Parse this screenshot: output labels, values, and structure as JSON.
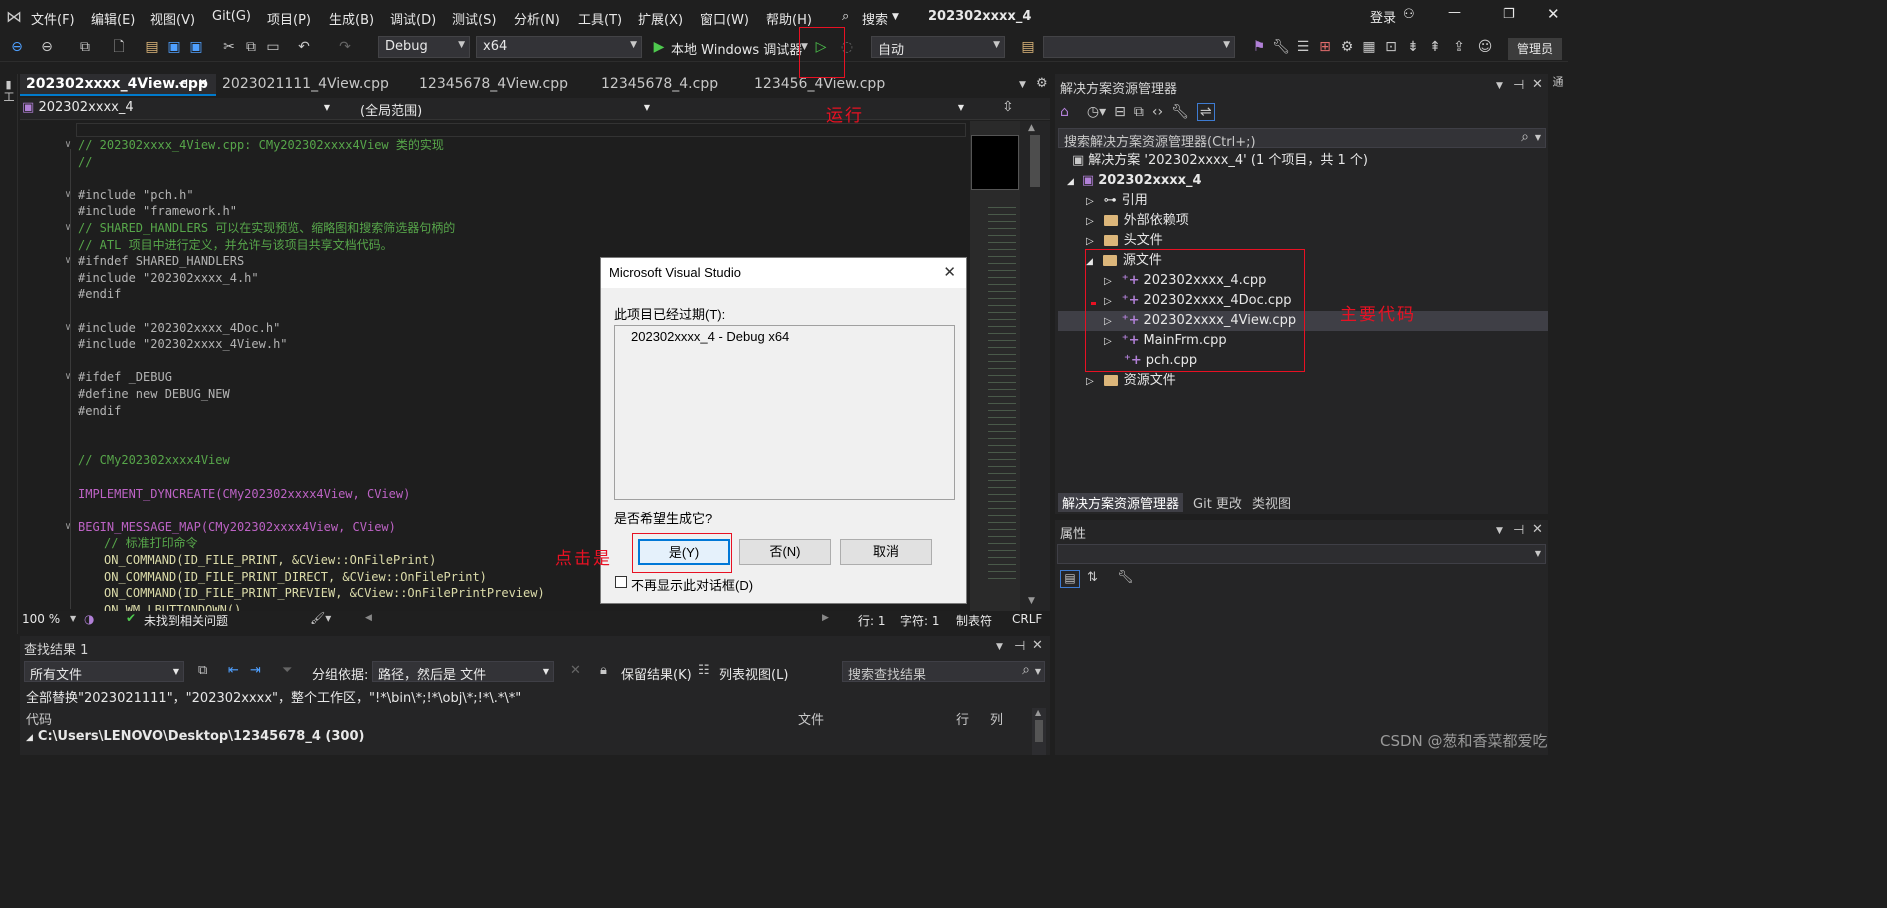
{
  "menu": {
    "items": [
      "文件(F)",
      "编辑(E)",
      "视图(V)",
      "Git(G)",
      "项目(P)",
      "生成(B)",
      "调试(D)",
      "测试(S)",
      "分析(N)",
      "工具(T)",
      "扩展(X)",
      "窗口(W)",
      "帮助(H)"
    ],
    "search_label": "搜索",
    "window_title": "202302xxxx_4",
    "login": "登录",
    "admin": "管理员"
  },
  "toolbar": {
    "config": "Debug",
    "platform": "x64",
    "run_target": "本地 Windows 调试器",
    "auto": "自动"
  },
  "tabs": [
    "202302xxxx_4View.cpp",
    "2023021111_4View.cpp",
    "12345678_4View.cpp",
    "12345678_4.cpp",
    "123456_4View.cpp"
  ],
  "navbar": {
    "project": "202302xxxx_4",
    "scope": "(全局范围)"
  },
  "code": {
    "lines": [
      {
        "t": "// 202302xxxx_4View.cpp: CMy202302xxxx4View 类的实现",
        "c": "cm",
        "indent": 0,
        "fold": true
      },
      {
        "t": "//",
        "c": "cm",
        "indent": 0
      },
      {
        "t": "",
        "c": "",
        "indent": 0
      },
      {
        "t": "#include \"pch.h\"",
        "c": "pp",
        "indent": 0,
        "fold": true
      },
      {
        "t": "#include \"framework.h\"",
        "c": "pp",
        "indent": 0
      },
      {
        "t": "// SHARED_HANDLERS 可以在实现预览、缩略图和搜索筛选器句柄的",
        "c": "cm",
        "indent": 0,
        "fold": true
      },
      {
        "t": "// ATL 项目中进行定义，并允许与该项目共享文档代码。",
        "c": "cm",
        "indent": 0
      },
      {
        "t": "#ifndef SHARED_HANDLERS",
        "c": "pp",
        "indent": 0,
        "fold": true
      },
      {
        "t": "#include \"202302xxxx_4.h\"",
        "c": "pp",
        "indent": 0
      },
      {
        "t": "#endif",
        "c": "pp",
        "indent": 0
      },
      {
        "t": "",
        "c": "",
        "indent": 0
      },
      {
        "t": "#include \"202302xxxx_4Doc.h\"",
        "c": "pp",
        "indent": 0,
        "fold": true
      },
      {
        "t": "#include \"202302xxxx_4View.h\"",
        "c": "pp",
        "indent": 0
      },
      {
        "t": "",
        "c": "",
        "indent": 0
      },
      {
        "t": "#ifdef _DEBUG",
        "c": "pp",
        "indent": 0,
        "fold": true
      },
      {
        "t": "#define new DEBUG_NEW",
        "c": "pp",
        "indent": 0
      },
      {
        "t": "#endif",
        "c": "pp",
        "indent": 0
      },
      {
        "t": "",
        "c": "",
        "indent": 0
      },
      {
        "t": "",
        "c": "",
        "indent": 0
      },
      {
        "t": "// CMy202302xxxx4View",
        "c": "cm",
        "indent": 0
      },
      {
        "t": "",
        "c": "",
        "indent": 0
      },
      {
        "t": "IMPLEMENT_DYNCREATE(CMy202302xxxx4View, CView)",
        "c": "mac",
        "indent": 0
      },
      {
        "t": "",
        "c": "",
        "indent": 0
      },
      {
        "t": "BEGIN_MESSAGE_MAP(CMy202302xxxx4View, CView)",
        "c": "mac",
        "indent": 0,
        "fold": true
      },
      {
        "t": "// 标准打印命令",
        "c": "cm",
        "indent": 2
      },
      {
        "t": "ON_COMMAND(ID_FILE_PRINT, &CView::OnFilePrint)",
        "c": "fn",
        "indent": 2
      },
      {
        "t": "ON_COMMAND(ID_FILE_PRINT_DIRECT, &CView::OnFilePrint)",
        "c": "fn",
        "indent": 2
      },
      {
        "t": "ON_COMMAND(ID_FILE_PRINT_PREVIEW, &CView::OnFilePrintPreview)",
        "c": "fn",
        "indent": 2
      },
      {
        "t": "ON_WM_LBUTTONDOWN()",
        "c": "fn",
        "indent": 2
      }
    ]
  },
  "editor_status": {
    "zoom": "100 %",
    "issues": "未找到相关问题",
    "line": "行: 1",
    "char": "字符: 1",
    "tabs": "制表符",
    "eol": "CRLF"
  },
  "solution": {
    "title": "解决方案资源管理器",
    "search_placeholder": "搜索解决方案资源管理器(Ctrl+;)",
    "root": "解决方案 '202302xxxx_4' (1 个项目，共 1 个)",
    "project": "202302xxxx_4",
    "nodes": {
      "refs": "引用",
      "external": "外部依赖项",
      "headers": "头文件",
      "sources": "源文件",
      "resources": "资源文件"
    },
    "source_files": [
      "202302xxxx_4.cpp",
      "202302xxxx_4Doc.cpp",
      "202302xxxx_4View.cpp",
      "MainFrm.cpp",
      "pch.cpp"
    ],
    "bottom_tabs": [
      "解决方案资源管理器",
      "Git 更改",
      "类视图"
    ]
  },
  "properties": {
    "title": "属性"
  },
  "find": {
    "title": "查找结果 1",
    "scope": "所有文件",
    "group_label": "分组依据:",
    "group_value": "路径，然后是 文件",
    "keep": "保留结果(K)",
    "list_view": "列表视图(L)",
    "search_placeholder": "搜索查找结果",
    "summary": "全部替换\"2023021111\"，\"202302xxxx\"，整个工作区，\"!*\\bin\\*;!*\\obj\\*;!*\\.*\\*\"",
    "cols": [
      "代码",
      "文件",
      "行",
      "列"
    ],
    "result_path": "C:\\Users\\LENOVO\\Desktop\\12345678_4 (300)"
  },
  "dialog": {
    "title": "Microsoft Visual Studio",
    "message": "此项目已经过期(T):",
    "item": "202302xxxx_4 - Debug x64",
    "question": "是否希望生成它?",
    "yes": "是(Y)",
    "no": "否(N)",
    "cancel": "取消",
    "dont_show": "不再显示此对话框(D)"
  },
  "annotations": {
    "run": "运行",
    "click_yes": "点击是",
    "main_code": "主要代码"
  },
  "watermark": "CSDN @葱和香菜都爱吃",
  "colors": {
    "accent": "#007acc",
    "annotation": "#e81123",
    "run_green": "#4ec94e"
  }
}
